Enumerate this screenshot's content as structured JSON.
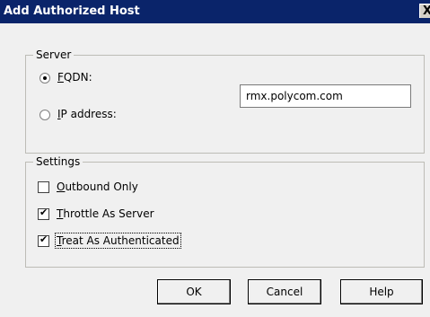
{
  "window": {
    "title": "Add Authorized Host",
    "close_glyph": "X"
  },
  "server_group": {
    "legend": "Server",
    "fqdn": {
      "mnemonic": "F",
      "rest": "QDN:",
      "selected": true
    },
    "ip": {
      "mnemonic": "I",
      "rest": "P address:",
      "selected": false
    },
    "host_value": "rmx.polycom.com"
  },
  "settings_group": {
    "legend": "Settings",
    "items": [
      {
        "mnemonic": "O",
        "rest": "utbound Only",
        "checked": false
      },
      {
        "mnemonic": "T",
        "rest": "hrottle As Server",
        "checked": true
      },
      {
        "mnemonic": "T",
        "rest": "reat As Authenticated",
        "checked": true
      }
    ]
  },
  "buttons": {
    "ok": "OK",
    "cancel": "Cancel",
    "help": "Help"
  }
}
